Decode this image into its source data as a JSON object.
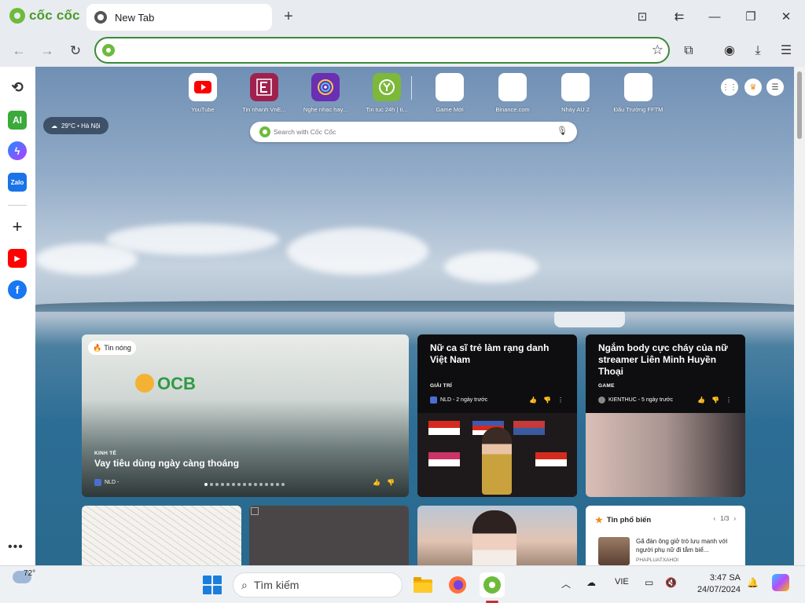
{
  "browser": {
    "brand": "cốc cốc",
    "tab_title": "New Tab",
    "address_value": "",
    "address_placeholder": ""
  },
  "weather_pill": {
    "text": "29°C • Hà Nội"
  },
  "speed_dial": [
    {
      "label": "YouTube",
      "icon": "youtube-icon",
      "color": "#ff0000"
    },
    {
      "label": "Tin nhanh VnE...",
      "icon": "vne-icon",
      "color": "#9f224e"
    },
    {
      "label": "Nghe nhạc hay...",
      "icon": "music-icon",
      "color": "#6a2fb3"
    },
    {
      "label": "Tin tuc 24h | ti...",
      "icon": "news24h-icon",
      "color": "#7cb83a"
    },
    {
      "label": "Game Mới",
      "icon": "blank-icon",
      "color": "#ffffff"
    },
    {
      "label": "Binance.com",
      "icon": "blank-icon",
      "color": "#ffffff"
    },
    {
      "label": "Nhảy AU 2",
      "icon": "blank-icon",
      "color": "#ffffff"
    },
    {
      "label": "Đấu Trường FFTM",
      "icon": "blank-icon",
      "color": "#ffffff"
    }
  ],
  "newtab_search": {
    "placeholder": "Search with Cốc Cốc"
  },
  "news": {
    "hot": {
      "badge": "Tin nóng",
      "sign": "OCB",
      "category": "KINH TẾ",
      "title": "Vay tiêu dùng ngày càng thoáng",
      "source": "NLD -"
    },
    "card2": {
      "title": "Nữ ca sĩ trẻ làm rạng danh Việt Nam",
      "category": "GIẢI TRÍ",
      "source": "NLD - 2 ngày trước"
    },
    "card3": {
      "title": "Ngắm body cực cháy của nữ streamer Liên Minh Huyền Thoại",
      "category": "GAME",
      "source": "KIENTHUC - 5 ngày trước"
    },
    "popular": {
      "heading": "Tin phổ biến",
      "pager": "1/3",
      "item_title": "Gã đàn ông giở trò lưu manh với người phụ nữ đi tắm biể...",
      "item_source": "PHAPLUATXAHOI"
    }
  },
  "taskbar": {
    "temperature": "72°",
    "search_placeholder": "Tìm kiếm",
    "language": "VIE",
    "time": "3:47 SA",
    "date": "24/07/2024"
  },
  "colors": {
    "brand_green": "#6dbb3c",
    "omnibox_border": "#3a8a3a",
    "accent_orange": "#f08a1c"
  }
}
